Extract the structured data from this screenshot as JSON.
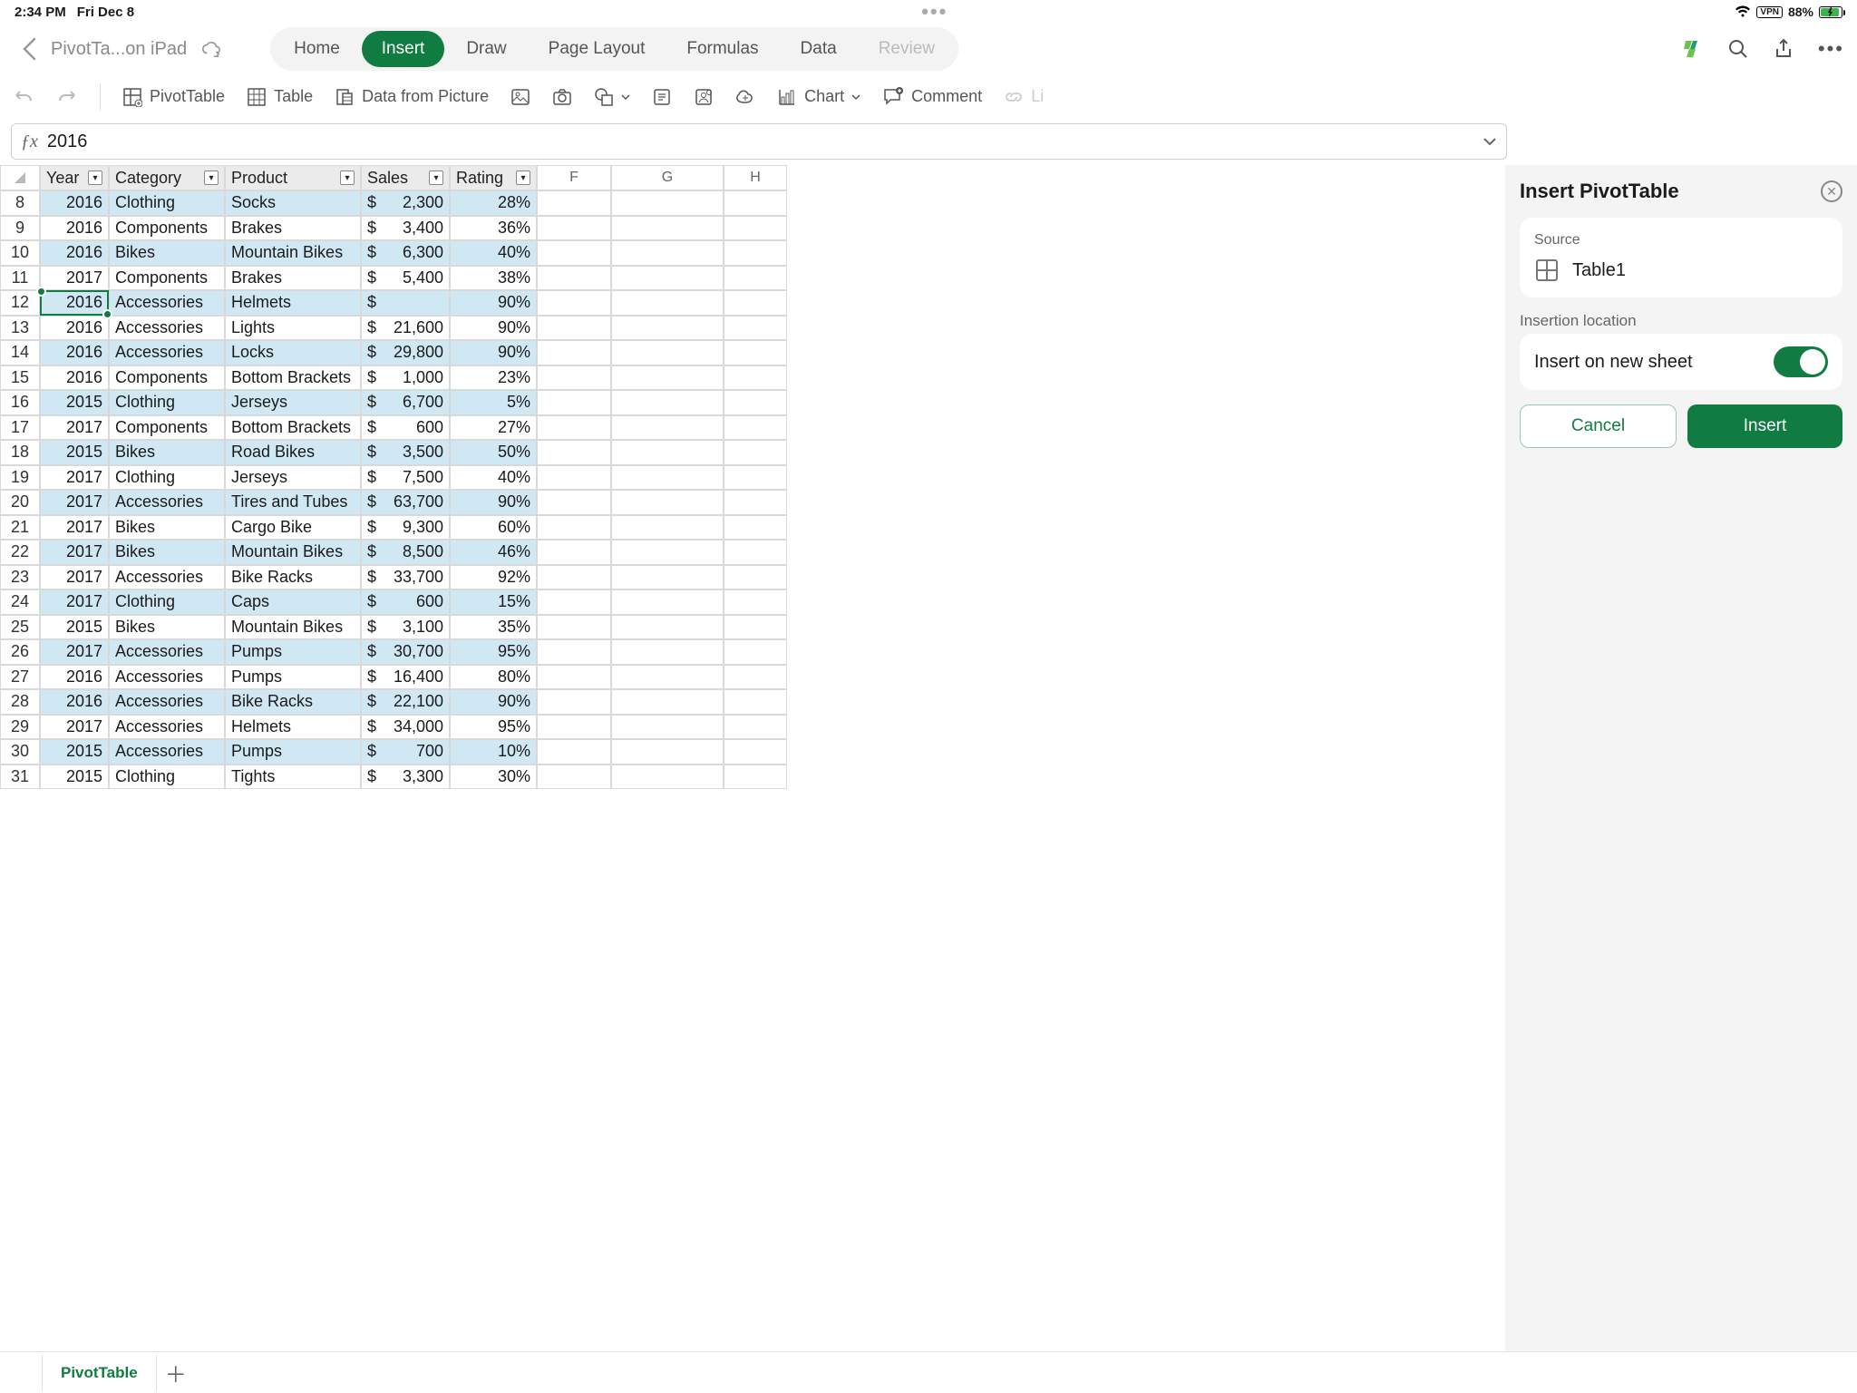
{
  "status": {
    "time": "2:34 PM",
    "date": "Fri Dec 8",
    "vpn": "VPN",
    "battery": "88%"
  },
  "appbar": {
    "doc_title": "PivotTa...on iPad",
    "tabs": [
      "Home",
      "Insert",
      "Draw",
      "Page Layout",
      "Formulas",
      "Data",
      "Review"
    ],
    "active_tab": "Insert"
  },
  "toolbar": {
    "pivottable": "PivotTable",
    "table": "Table",
    "data_from_picture": "Data from Picture",
    "chart": "Chart",
    "comment": "Comment",
    "link": "Li"
  },
  "formula": {
    "value": "2016"
  },
  "sheet": {
    "col_labels": {
      "extra": [
        "F",
        "G",
        "H"
      ]
    },
    "headers": {
      "year": "Year",
      "category": "Category",
      "product": "Product",
      "sales": "Sales",
      "rating": "Rating"
    },
    "selected_row": 12,
    "rows": [
      {
        "n": 8,
        "year": "2016",
        "category": "Clothing",
        "product": "Socks",
        "sales": "2,300",
        "rating": "28%"
      },
      {
        "n": 9,
        "year": "2016",
        "category": "Components",
        "product": "Brakes",
        "sales": "3,400",
        "rating": "36%"
      },
      {
        "n": 10,
        "year": "2016",
        "category": "Bikes",
        "product": "Mountain Bikes",
        "sales": "6,300",
        "rating": "40%"
      },
      {
        "n": 11,
        "year": "2017",
        "category": "Components",
        "product": "Brakes",
        "sales": "5,400",
        "rating": "38%"
      },
      {
        "n": 12,
        "year": "2016",
        "category": "Accessories",
        "product": "Helmets",
        "sales": "",
        "rating": "90%"
      },
      {
        "n": 13,
        "year": "2016",
        "category": "Accessories",
        "product": "Lights",
        "sales": "21,600",
        "rating": "90%"
      },
      {
        "n": 14,
        "year": "2016",
        "category": "Accessories",
        "product": "Locks",
        "sales": "29,800",
        "rating": "90%"
      },
      {
        "n": 15,
        "year": "2016",
        "category": "Components",
        "product": "Bottom Brackets",
        "sales": "1,000",
        "rating": "23%"
      },
      {
        "n": 16,
        "year": "2015",
        "category": "Clothing",
        "product": "Jerseys",
        "sales": "6,700",
        "rating": "5%"
      },
      {
        "n": 17,
        "year": "2017",
        "category": "Components",
        "product": "Bottom Brackets",
        "sales": "600",
        "rating": "27%"
      },
      {
        "n": 18,
        "year": "2015",
        "category": "Bikes",
        "product": "Road Bikes",
        "sales": "3,500",
        "rating": "50%"
      },
      {
        "n": 19,
        "year": "2017",
        "category": "Clothing",
        "product": "Jerseys",
        "sales": "7,500",
        "rating": "40%"
      },
      {
        "n": 20,
        "year": "2017",
        "category": "Accessories",
        "product": "Tires and Tubes",
        "sales": "63,700",
        "rating": "90%"
      },
      {
        "n": 21,
        "year": "2017",
        "category": "Bikes",
        "product": "Cargo Bike",
        "sales": "9,300",
        "rating": "60%"
      },
      {
        "n": 22,
        "year": "2017",
        "category": "Bikes",
        "product": "Mountain Bikes",
        "sales": "8,500",
        "rating": "46%"
      },
      {
        "n": 23,
        "year": "2017",
        "category": "Accessories",
        "product": "Bike Racks",
        "sales": "33,700",
        "rating": "92%"
      },
      {
        "n": 24,
        "year": "2017",
        "category": "Clothing",
        "product": "Caps",
        "sales": "600",
        "rating": "15%"
      },
      {
        "n": 25,
        "year": "2015",
        "category": "Bikes",
        "product": "Mountain Bikes",
        "sales": "3,100",
        "rating": "35%"
      },
      {
        "n": 26,
        "year": "2017",
        "category": "Accessories",
        "product": "Pumps",
        "sales": "30,700",
        "rating": "95%"
      },
      {
        "n": 27,
        "year": "2016",
        "category": "Accessories",
        "product": "Pumps",
        "sales": "16,400",
        "rating": "80%"
      },
      {
        "n": 28,
        "year": "2016",
        "category": "Accessories",
        "product": "Bike Racks",
        "sales": "22,100",
        "rating": "90%"
      },
      {
        "n": 29,
        "year": "2017",
        "category": "Accessories",
        "product": "Helmets",
        "sales": "34,000",
        "rating": "95%"
      },
      {
        "n": 30,
        "year": "2015",
        "category": "Accessories",
        "product": "Pumps",
        "sales": "700",
        "rating": "10%"
      },
      {
        "n": 31,
        "year": "2015",
        "category": "Clothing",
        "product": "Tights",
        "sales": "3,300",
        "rating": "30%"
      }
    ]
  },
  "panel": {
    "title": "Insert PivotTable",
    "source_label": "Source",
    "source_name": "Table1",
    "location_label": "Insertion location",
    "insert_new_sheet": "Insert on new sheet",
    "cancel": "Cancel",
    "insert": "Insert"
  },
  "tabs_bottom": {
    "active": "PivotTable"
  }
}
